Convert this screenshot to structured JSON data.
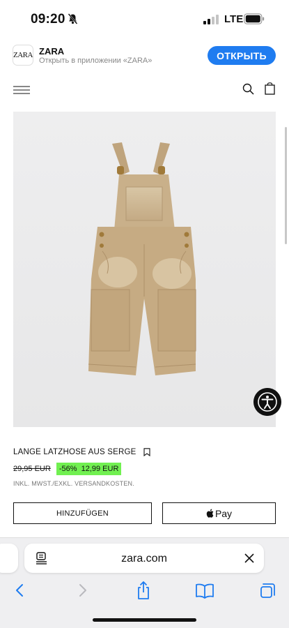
{
  "status_bar": {
    "time": "09:20",
    "network": "LTE",
    "icons": [
      "bell-slash-icon",
      "signal-icon",
      "battery-icon"
    ]
  },
  "app_banner": {
    "logo": "ZARA",
    "app_name": "ZARA",
    "subtitle": "Открыть в приложении «ZARA»",
    "open_label": "ОТКРЫТЬ",
    "accent": "#1f7cf0"
  },
  "header": {
    "icons": [
      "menu-icon",
      "search-icon",
      "shopping-bag-icon"
    ]
  },
  "product": {
    "name": "LANGE LATZHOSE AUS SERGE",
    "old_price": "29,95 EUR",
    "sale_text": "-56%  12,99 EUR",
    "sale_color": "#71f051",
    "tax_note": "INKL. MWST./EXKL. VERSANDKOSTEN.",
    "add_label": "HINZUFÜGEN",
    "pay_label": "Pay",
    "image_subject": "beige kids denim overalls"
  },
  "browser": {
    "url": "zara.com",
    "icons": [
      "back-icon",
      "forward-icon",
      "share-icon",
      "bookmarks-icon",
      "tabs-icon"
    ]
  }
}
